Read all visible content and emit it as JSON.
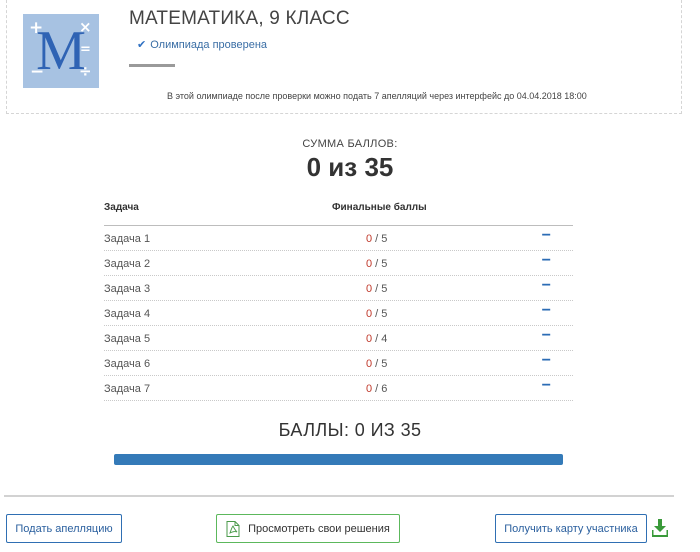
{
  "header": {
    "title": "МАТЕМАТИКА, 9 КЛАСС",
    "status": "Олимпиада проверена",
    "appeal_info": "В этой олимпиаде после проверки можно подать 7 апелляций через интерфейс до 04.04.2018 18:00",
    "logo": {
      "letter": "M",
      "symbols": [
        "+",
        "×",
        "−",
        "÷",
        "="
      ]
    }
  },
  "summary": {
    "label": "СУММА БАЛЛОВ:",
    "value": "0 из 35"
  },
  "table": {
    "headers": {
      "task": "Задача",
      "final": "Финальные баллы"
    },
    "rows": [
      {
        "name": "Задача 1",
        "earned": "0",
        "max": " / 5"
      },
      {
        "name": "Задача 2",
        "earned": "0",
        "max": " / 5"
      },
      {
        "name": "Задача 3",
        "earned": "0",
        "max": " / 5"
      },
      {
        "name": "Задача 4",
        "earned": "0",
        "max": " / 5"
      },
      {
        "name": "Задача 5",
        "earned": "0",
        "max": " / 4"
      },
      {
        "name": "Задача 6",
        "earned": "0",
        "max": " / 5"
      },
      {
        "name": "Задача 7",
        "earned": "0",
        "max": " / 6"
      }
    ],
    "toggle_symbol": "−"
  },
  "points": {
    "label": "БАЛЛЫ: 0 ИЗ 35",
    "progress_fraction": 1.0
  },
  "buttons": {
    "appeal": "Подать апелляцию",
    "view_solutions": "Просмотреть свои решения",
    "participant_card": "Получить карту участника"
  },
  "icons": {
    "check": "check-icon",
    "document": "pdf-document-icon",
    "download": "download-icon"
  },
  "colors": {
    "accent": "#2f6fb3",
    "progress": "#347ab8",
    "score_earned": "#c0392b",
    "success_border": "#5cb85c",
    "download": "#3a9a3a"
  }
}
